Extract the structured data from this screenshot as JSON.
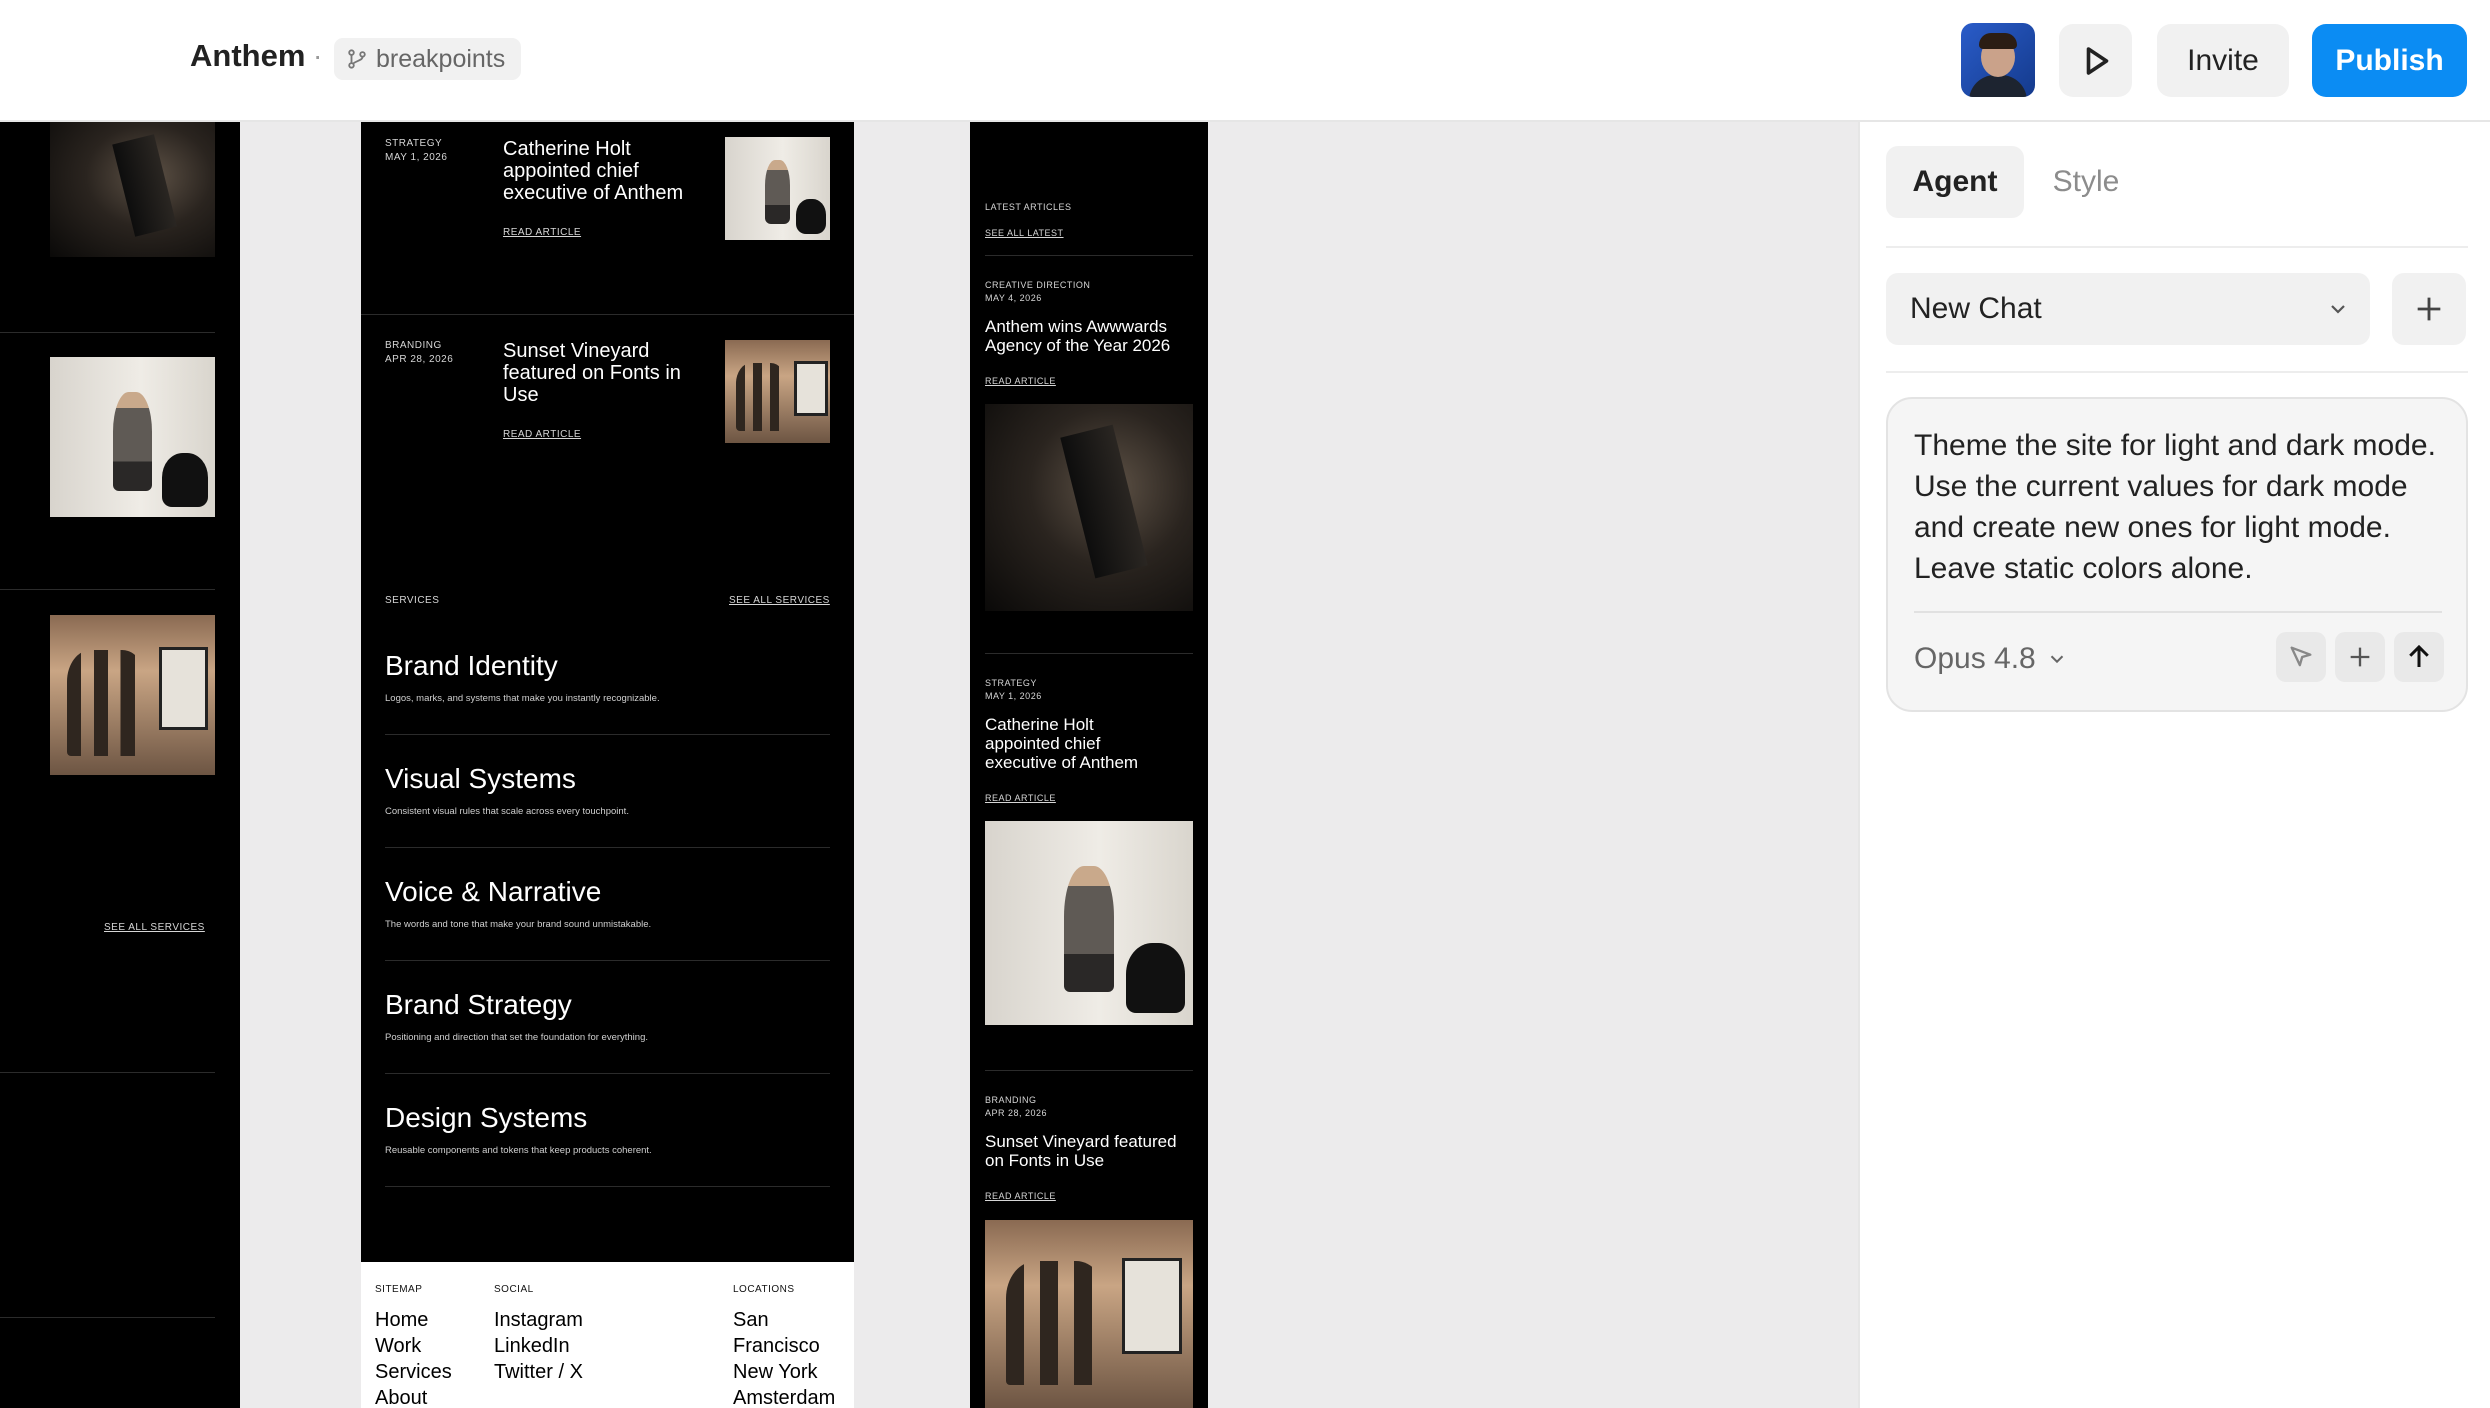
{
  "topbar": {
    "project": "Anthem",
    "separator": "·",
    "branch": "breakpoints",
    "invite": "Invite",
    "publish": "Publish"
  },
  "colors": {
    "accent": "#0b8cf3",
    "frame_bg": "#000000",
    "canvas_bg": "#ecebec"
  },
  "icons": {
    "branch": "git-branch-icon",
    "play": "play-icon",
    "chevron": "chevron-down-icon",
    "plus": "plus-icon",
    "send": "arrow-up-icon",
    "pointer": "cursor-icon"
  },
  "frame_small": {
    "see_all": "SEE ALL SERVICES"
  },
  "frame_mid": {
    "articles": [
      {
        "cat": "STRATEGY",
        "date": "MAY 1, 2026",
        "title": "Catherine Holt appointed chief executive of Anthem",
        "link": "READ ARTICLE"
      },
      {
        "cat": "BRANDING",
        "date": "APR 28, 2026",
        "title": "Sunset Vineyard featured on Fonts in Use",
        "link": "READ ARTICLE"
      }
    ],
    "services_label": "SERVICES",
    "see_all": "SEE ALL SERVICES",
    "services": [
      {
        "name": "Brand Identity",
        "desc": "Logos, marks, and systems that make you instantly recognizable."
      },
      {
        "name": "Visual Systems",
        "desc": "Consistent visual rules that scale across every touchpoint."
      },
      {
        "name": "Voice & Narrative",
        "desc": "The words and tone that make your brand sound unmistakable."
      },
      {
        "name": "Brand Strategy",
        "desc": "Positioning and direction that set the foundation for everything."
      },
      {
        "name": "Design Systems",
        "desc": "Reusable components and tokens that keep products coherent."
      }
    ],
    "footer": {
      "sitemap_label": "SITEMAP",
      "sitemap": [
        "Home",
        "Work",
        "Services",
        "About"
      ],
      "social_label": "SOCIAL",
      "social": [
        "Instagram",
        "LinkedIn",
        "Twitter / X"
      ],
      "locations_label": "LOCATIONS",
      "locations": [
        "San Francisco",
        "New York",
        "Amsterdam"
      ]
    }
  },
  "frame_narrow": {
    "latest_label": "LATEST ARTICLES",
    "see_all": "SEE ALL LATEST",
    "articles": [
      {
        "cat": "CREATIVE DIRECTION",
        "date": "MAY 4, 2026",
        "title": "Anthem wins Awwwards Agency of the Year 2026",
        "link": "READ ARTICLE"
      },
      {
        "cat": "STRATEGY",
        "date": "MAY 1, 2026",
        "title": "Catherine Holt appointed chief executive of Anthem",
        "link": "READ ARTICLE"
      },
      {
        "cat": "BRANDING",
        "date": "APR 28, 2026",
        "title": "Sunset Vineyard featured on Fonts in Use",
        "link": "READ ARTICLE"
      }
    ]
  },
  "panel": {
    "tabs": [
      "Agent",
      "Style"
    ],
    "chat_select": "New Chat",
    "prompt": "Theme the site for light and dark mode. Use the current values for dark mode and create new ones for light mode. Leave static colors alone.",
    "model": "Opus 4.8"
  }
}
